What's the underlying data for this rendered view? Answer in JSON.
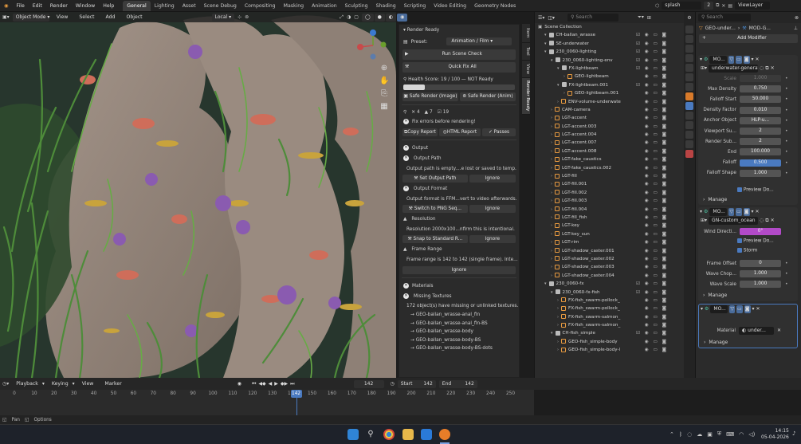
{
  "menubar": {
    "menus": [
      "File",
      "Edit",
      "Render",
      "Window",
      "Help"
    ],
    "workspaces": [
      "General",
      "Lighting",
      "Asset",
      "Scene Debug",
      "Compositing",
      "Masking",
      "Animation",
      "Sculpting",
      "Shading",
      "Scripting",
      "Video Editing",
      "Geometry Nodes"
    ],
    "active_workspace": "General",
    "scene_name": "splash",
    "scene_count": "2",
    "view_layer": "ViewLayer"
  },
  "viewport_header": {
    "mode": "Object Mode",
    "menus": [
      "View",
      "Select",
      "Add",
      "Object"
    ],
    "orientation": "Local"
  },
  "sidebar_tabs": [
    "Item",
    "Tool",
    "View",
    "Render Ready"
  ],
  "render_panel": {
    "title": "Render Ready",
    "preset_label": "Preset:",
    "preset_value": "Animation / Film",
    "run_check": "Run Scene Check",
    "quick_fix": "Quick Fix All",
    "health": "Health Score: 19 / 100 — NOT Ready",
    "health_fraction": 0.19,
    "safe_image": "Safe Render (Image)",
    "safe_anim": "Safe Render (Anim)",
    "count_errors": "4",
    "count_warnings": "7",
    "count_ok": "19",
    "fix_errors": "Fix errors before rendering!",
    "copy_report": "Copy Report",
    "html_report": "HTML Report",
    "passes": "Passes",
    "section_output": "Output",
    "output_path_title": "Output Path",
    "output_path_msg": "Output path is empty....e lost or saved to temp.",
    "set_output_path": "Set Output Path",
    "ignore": "Ignore",
    "output_format_title": "Output Format",
    "output_format_msg": "Output format is FFM...vert to video afterwards.",
    "switch_png": "Switch to PNG Seq...",
    "resolution_title": "Resolution",
    "resolution_msg": "Resolution 2000x100...nfirm this is intentional.",
    "snap_res": "Snap to Standard R...",
    "frame_range_title": "Frame Range",
    "frame_range_msg": "Frame range is 142 to 142 (single frame). Inte...",
    "section_materials": "Materials",
    "missing_textures": "Missing Textures",
    "missing_msg": "172 object(s) have missing or unlinked textures.",
    "missing_items": [
      "→ GEO-ballan_wrasse-anal_fin",
      "→ GEO-ballan_wrasse-anal_fin-BS",
      "→ GEO-ballan_wrasse-body",
      "→ GEO-ballan_wrasse-body-BS",
      "→ GEO-ballan_wrasse-body-BS-dots"
    ]
  },
  "outliner": {
    "search_placeholder": "Search",
    "root": "Scene Collection",
    "rows": [
      {
        "name": "CH-ballan_wrasse",
        "indent": 1,
        "type": "coll"
      },
      {
        "name": "SE-underwater",
        "indent": 1,
        "type": "coll"
      },
      {
        "name": "230_0060-lighting",
        "indent": 1,
        "type": "coll"
      },
      {
        "name": "230_0060-lighting-env",
        "indent": 2,
        "type": "coll"
      },
      {
        "name": "FX-lightbeam",
        "indent": 3,
        "type": "coll"
      },
      {
        "name": "GEO-lightbeam",
        "indent": 4,
        "type": "obj"
      },
      {
        "name": "FX-lightbeam.001",
        "indent": 3,
        "type": "coll"
      },
      {
        "name": "GEO-lightbeam.001",
        "indent": 4,
        "type": "obj"
      },
      {
        "name": "ENV-volume-underwate",
        "indent": 3,
        "type": "obj"
      },
      {
        "name": "CAM-camera",
        "indent": 2,
        "type": "obj"
      },
      {
        "name": "LGT-accent",
        "indent": 2,
        "type": "light"
      },
      {
        "name": "LGT-accent.003",
        "indent": 2,
        "type": "light"
      },
      {
        "name": "LGT-accent.004",
        "indent": 2,
        "type": "light"
      },
      {
        "name": "LGT-accent.007",
        "indent": 2,
        "type": "light"
      },
      {
        "name": "LGT-accent.008",
        "indent": 2,
        "type": "light"
      },
      {
        "name": "LGT-fake_caustics",
        "indent": 2,
        "type": "light"
      },
      {
        "name": "LGT-fake_caustics.002",
        "indent": 2,
        "type": "light"
      },
      {
        "name": "LGT-fill",
        "indent": 2,
        "type": "light"
      },
      {
        "name": "LGT-fill.001",
        "indent": 2,
        "type": "light"
      },
      {
        "name": "LGT-fill.002",
        "indent": 2,
        "type": "light"
      },
      {
        "name": "LGT-fill.003",
        "indent": 2,
        "type": "light"
      },
      {
        "name": "LGT-fill.004",
        "indent": 2,
        "type": "light"
      },
      {
        "name": "LGT-fill_fish",
        "indent": 2,
        "type": "light"
      },
      {
        "name": "LGT-key",
        "indent": 2,
        "type": "light"
      },
      {
        "name": "LGT-key_sun",
        "indent": 2,
        "type": "light"
      },
      {
        "name": "LGT-rim",
        "indent": 2,
        "type": "light"
      },
      {
        "name": "LGT-shadow_caster.001",
        "indent": 2,
        "type": "light"
      },
      {
        "name": "LGT-shadow_caster.002",
        "indent": 2,
        "type": "light"
      },
      {
        "name": "LGT-shadow_caster.003",
        "indent": 2,
        "type": "light"
      },
      {
        "name": "LGT-shadow_caster.004",
        "indent": 2,
        "type": "light"
      },
      {
        "name": "230_0060-fx",
        "indent": 1,
        "type": "coll"
      },
      {
        "name": "230_0060-fx-fish",
        "indent": 2,
        "type": "coll"
      },
      {
        "name": "FX-fish_swarm-pollock_",
        "indent": 3,
        "type": "fx"
      },
      {
        "name": "FX-fish_swarm-pollock_",
        "indent": 3,
        "type": "fx"
      },
      {
        "name": "FX-fish_swarm-salmon_",
        "indent": 3,
        "type": "fx"
      },
      {
        "name": "FX-fish_swarm-salmon_",
        "indent": 3,
        "type": "fx"
      },
      {
        "name": "CH-fish_simple",
        "indent": 2,
        "type": "coll"
      },
      {
        "name": "GEO-fish_simple-body",
        "indent": 3,
        "type": "fx"
      },
      {
        "name": "GEO-fish_simple-body-l",
        "indent": 3,
        "type": "fx"
      }
    ]
  },
  "properties": {
    "search_placeholder": "Search",
    "object_name": "GEO-under...",
    "modifier_name": "MOD-G...",
    "add_modifier": "Add Modifier",
    "mod1_short": "MO...",
    "mod1_node": "underwater-generat...",
    "fields1": [
      {
        "label": "Scale",
        "value": "1.000"
      },
      {
        "label": "Max Density",
        "value": "0.750"
      },
      {
        "label": "Falloff Start",
        "value": "50.000"
      },
      {
        "label": "Density Factor",
        "value": "0.010"
      },
      {
        "label": "Anchor Object",
        "value": "HLP-u..."
      },
      {
        "label": "Viewport Su...",
        "value": "2"
      },
      {
        "label": "Render Sub...",
        "value": "2"
      },
      {
        "label": "End",
        "value": "100.000"
      },
      {
        "label": "Falloff",
        "value": "0.500"
      },
      {
        "label": "Falloff Shape",
        "value": "1.000"
      }
    ],
    "preview_do": "Preview Do...",
    "manage": "Manage",
    "mod2_short": "MO...",
    "mod2_node": "GN-custom_ocean",
    "wind_label": "Wind Directi...",
    "wind_value": "0°",
    "storm": "Storm",
    "fields2": [
      {
        "label": "Frame Offset",
        "value": "0"
      },
      {
        "label": "Wave Chop...",
        "value": "1.000"
      },
      {
        "label": "Wave Scale",
        "value": "1.000"
      }
    ],
    "mod3_short": "MO...",
    "material_label": "Material",
    "material_value": "under..."
  },
  "timeline": {
    "menus": [
      "Playback",
      "Keying",
      "View",
      "Marker"
    ],
    "current_frame": "142",
    "start_label": "Start",
    "start": "142",
    "end_label": "End",
    "end": "142",
    "ticks": [
      "0",
      "10",
      "20",
      "30",
      "40",
      "50",
      "60",
      "70",
      "80",
      "90",
      "100",
      "110",
      "120",
      "130",
      "140",
      "150",
      "160",
      "170",
      "180",
      "190",
      "200",
      "210",
      "220",
      "230",
      "240",
      "250"
    ]
  },
  "statusbar": {
    "pan": "Pan",
    "options": "Options"
  },
  "taskbar": {
    "time": "14:15",
    "date": "05-04-2026"
  }
}
